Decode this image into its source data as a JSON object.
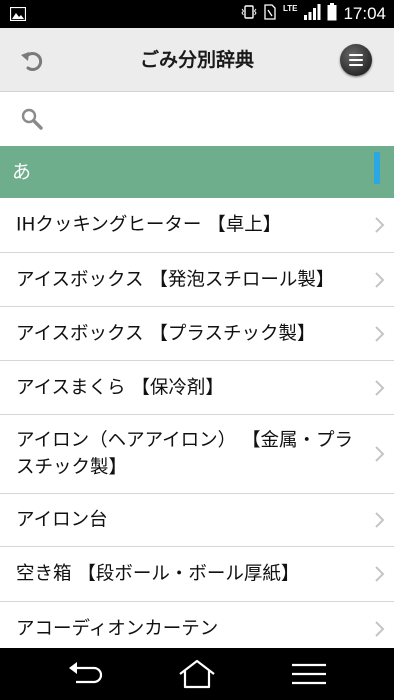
{
  "status_bar": {
    "network": "LTE",
    "time": "17:04"
  },
  "header": {
    "title": "ごみ分別辞典"
  },
  "search": {
    "placeholder": ""
  },
  "section": {
    "label": "あ"
  },
  "items": [
    {
      "label": "IHクッキングヒーター 【卓上】"
    },
    {
      "label": "アイスボックス 【発泡スチロール製】"
    },
    {
      "label": "アイスボックス 【プラスチック製】"
    },
    {
      "label": "アイスまくら 【保冷剤】"
    },
    {
      "label": "アイロン（ヘアアイロン） 【金属・プラスチック製】"
    },
    {
      "label": "アイロン台"
    },
    {
      "label": "空き箱 【段ボール・ボール厚紙】"
    },
    {
      "label": "アコーディオンカーテン"
    }
  ],
  "colors": {
    "section_bg": "#6fae8d",
    "scroll_accent": "#2aa7e4",
    "header_bg": "#ececec"
  },
  "icons": {
    "back": "undo-arrow-icon",
    "menu": "menu-icon",
    "search": "search-icon",
    "row": "chevron-right-icon"
  }
}
